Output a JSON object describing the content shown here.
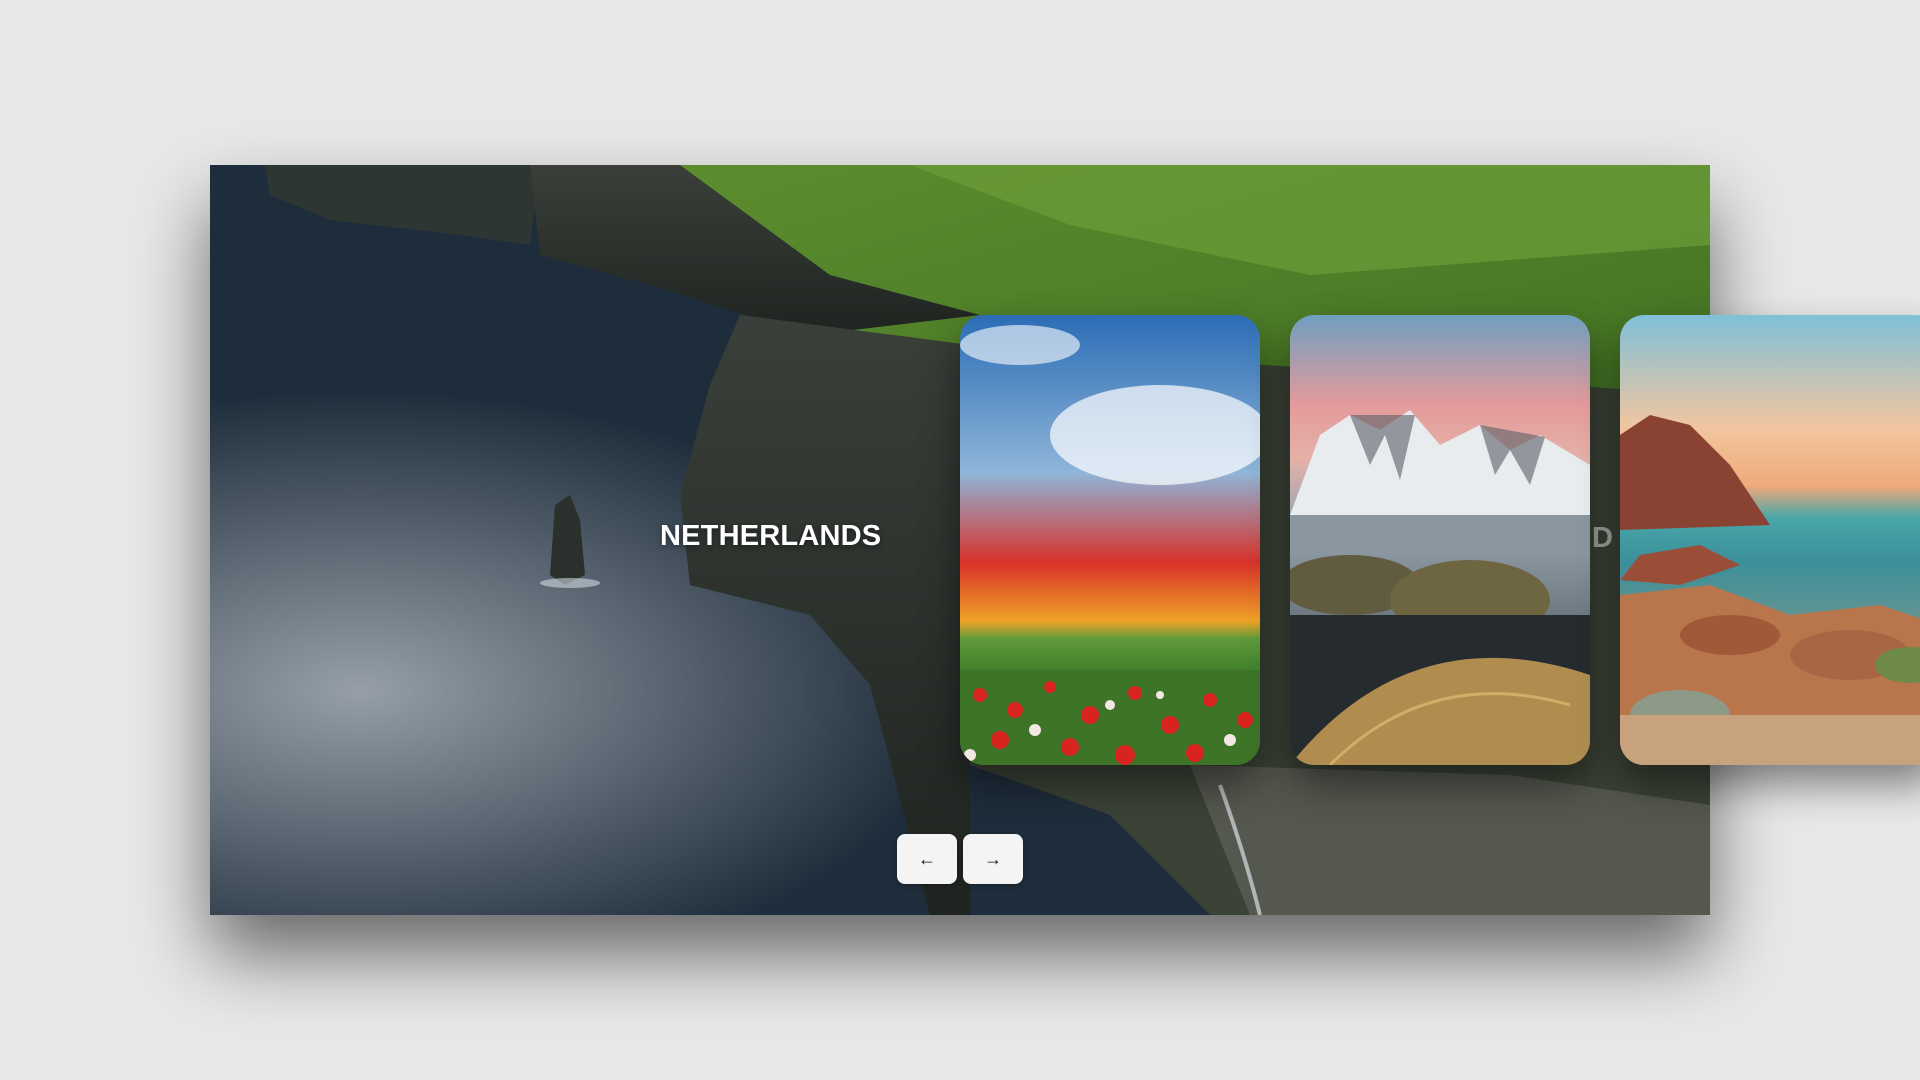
{
  "slider": {
    "current_title": "NETHERLANDS",
    "next_title_partial": "D",
    "cards": [
      {
        "name": "card-poppy-field",
        "icon": "poppy-field-image"
      },
      {
        "name": "card-snow-mountains",
        "icon": "snow-mountain-image"
      },
      {
        "name": "card-rocky-coast",
        "icon": "rocky-coast-image"
      }
    ]
  },
  "navigation": {
    "prev_icon": "←",
    "next_icon": "→"
  },
  "colors": {
    "page_background": "#e8e8e8",
    "button_background": "#f4f4f4",
    "title_text": "#ffffff"
  }
}
